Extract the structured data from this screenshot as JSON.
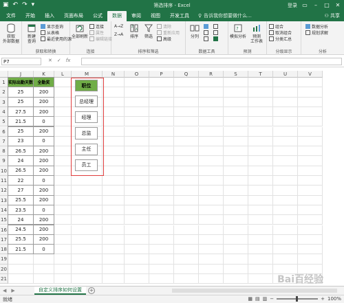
{
  "titlebar": {
    "title": "筛选排序 - Excel",
    "login": "登录"
  },
  "tabs": [
    {
      "label": "文件"
    },
    {
      "label": "开始"
    },
    {
      "label": "插入"
    },
    {
      "label": "页面布局"
    },
    {
      "label": "公式"
    },
    {
      "label": "数据"
    },
    {
      "label": "审阅"
    },
    {
      "label": "视图"
    },
    {
      "label": "开发工具"
    }
  ],
  "tellme": "告诉我你想要做什么...",
  "share": "共享",
  "ribbon": {
    "get_external": "获取\n外部数据",
    "new_query": "新建\n查询",
    "show_query": "显示查询",
    "from_table": "从表格",
    "recent_sources": "最近使用的源",
    "group_get_transform": "获取和转换",
    "refresh_all": "全部刷新",
    "connections": "连接",
    "properties": "属性",
    "edit_links": "编辑链接",
    "group_connections": "连接",
    "sort_asc": "A→Z",
    "sort_desc": "Z→A",
    "sort": "排序",
    "filter": "筛选",
    "clear": "清除",
    "reapply": "重新应用",
    "advanced": "高级",
    "group_sort_filter": "排序和筛选",
    "text_to_columns": "分列",
    "group_data_tools": "数据工具",
    "what_if": "模拟分析",
    "forecast_sheet": "预测\n工作表",
    "group_forecast": "预测",
    "group": "组合",
    "ungroup": "取消组合",
    "subtotal": "分类汇总",
    "group_outline": "分级显示",
    "data_analysis": "数据分析",
    "solver": "规划求解",
    "group_analysis": "分析"
  },
  "formula_bar": {
    "name_box": "P7",
    "fx": "fx",
    "value": ""
  },
  "columns": [
    "J",
    "K",
    "L",
    "M",
    "N",
    "O",
    "P",
    "Q",
    "R",
    "S",
    "T",
    "U",
    "V"
  ],
  "rows": [
    "1",
    "2",
    "3",
    "4",
    "5",
    "6",
    "7",
    "8",
    "9",
    "10",
    "11",
    "12",
    "13",
    "14",
    "15",
    "16",
    "17",
    "18",
    "19",
    "20",
    "21"
  ],
  "table_jk": {
    "header_j": "实际出勤天数",
    "header_k": "全勤奖",
    "rows": [
      [
        "25",
        "200"
      ],
      [
        "25",
        "200"
      ],
      [
        "27.5",
        "200"
      ],
      [
        "21.5",
        "0"
      ],
      [
        "25",
        "200"
      ],
      [
        "23",
        "0"
      ],
      [
        "26.5",
        "200"
      ],
      [
        "24",
        "200"
      ],
      [
        "26.5",
        "200"
      ],
      [
        "22",
        "0"
      ],
      [
        "27",
        "200"
      ],
      [
        "25.5",
        "200"
      ],
      [
        "23.5",
        "0"
      ],
      [
        "24",
        "200"
      ],
      [
        "24.5",
        "200"
      ],
      [
        "25.5",
        "200"
      ],
      [
        "21.5",
        "0"
      ]
    ]
  },
  "table_m": {
    "header": "职位",
    "items": [
      "总经理",
      "经理",
      "总监",
      "主任",
      "员工"
    ]
  },
  "sheet": {
    "tab_label": "自定义排序如何设置"
  },
  "status": {
    "ready": "就绪",
    "zoom": "100%"
  },
  "watermark": "Bai百经验",
  "colors": {
    "excel_green": "#217346",
    "header_fill": "#70ad47",
    "highlight": "#e03c3c"
  }
}
